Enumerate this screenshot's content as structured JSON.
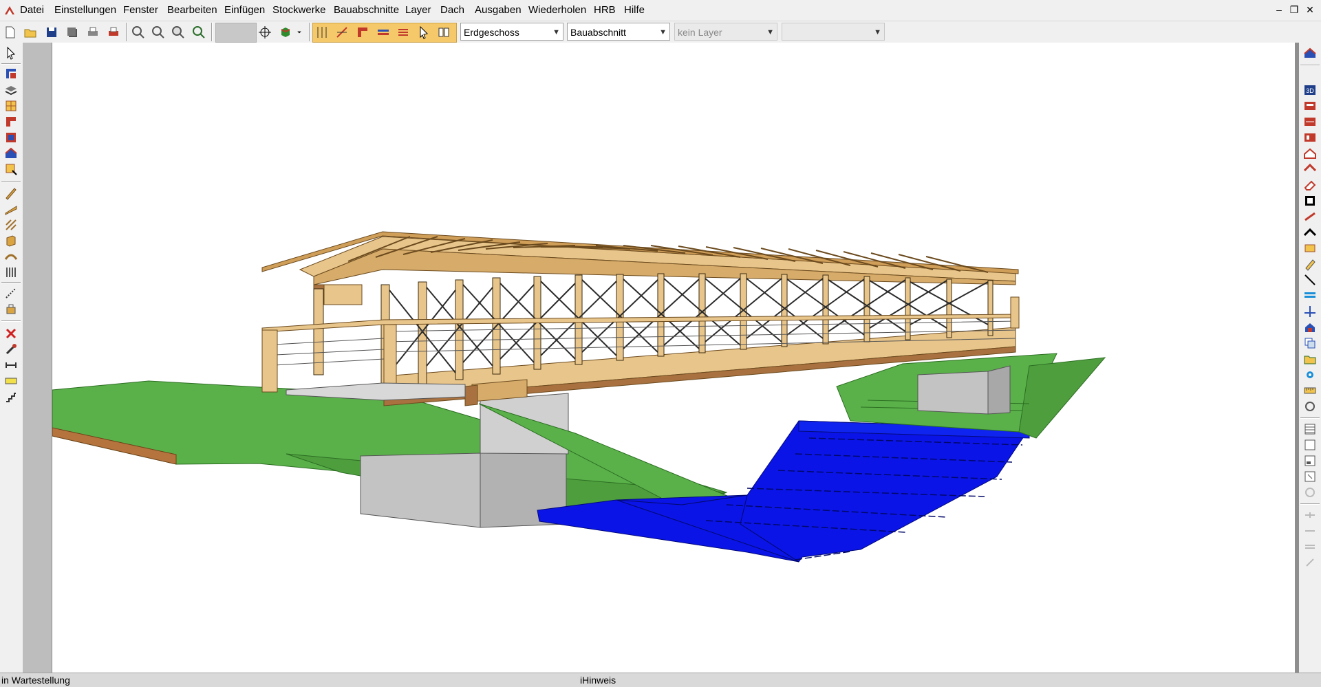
{
  "menu": {
    "items": [
      "Datei",
      "Einstellungen",
      "Fenster",
      "Bearbeiten",
      "Einfügen",
      "Stockwerke",
      "Bauabschnitte",
      "Layer",
      "Dach",
      "Ausgaben",
      "Wiederholen",
      "HRB",
      "Hilfe"
    ]
  },
  "window_controls": {
    "minimize": "–",
    "restore": "❐",
    "close": "✕"
  },
  "toolbar": {
    "floor_select": "Erdgeschoss",
    "section_select": "Bauabschnitt",
    "layer_select": "kein Layer",
    "extra_select": ""
  },
  "status": {
    "left": "in Wartestellung",
    "hint": "iHinweis"
  },
  "colors": {
    "wood": "#e8c58a",
    "wood_dark": "#a9713f",
    "grass": "#55b046",
    "water": "#0a14e6",
    "concrete": "#c3c3c3"
  }
}
